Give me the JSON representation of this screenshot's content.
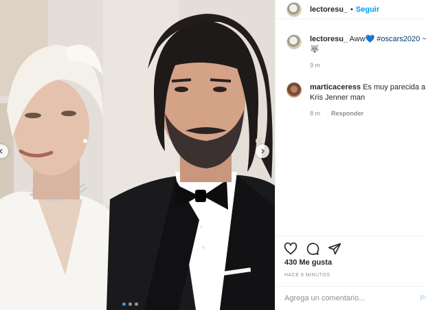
{
  "header": {
    "username": "lectoresu_",
    "separator": "•",
    "follow_label": "Seguir"
  },
  "caption": {
    "username": "lectoresu_",
    "text": "Aww💙",
    "hashtag": "#oscars2020",
    "hashtag_suffix": "~",
    "emoji": "🐺",
    "time": "9 m"
  },
  "comments": [
    {
      "username": "marticaceress",
      "text": "Es muy parecida a Kris Jenner man",
      "time": "8 m",
      "reply_label": "Responder"
    }
  ],
  "actions": {
    "icons": [
      "heart-icon",
      "comment-icon",
      "share-icon"
    ]
  },
  "likes_text": "430 Me gusta",
  "timestamp": "HACE 9 MINUTOS",
  "add_comment": {
    "placeholder": "Agrega un comentario...",
    "publish_label": "Pu"
  },
  "carousel": {
    "count": 3,
    "active_index": 0
  },
  "colors": {
    "link_blue": "#0095f6",
    "carousel_active": "#3897f0",
    "border": "#efefef",
    "muted": "#8e8e8e"
  }
}
